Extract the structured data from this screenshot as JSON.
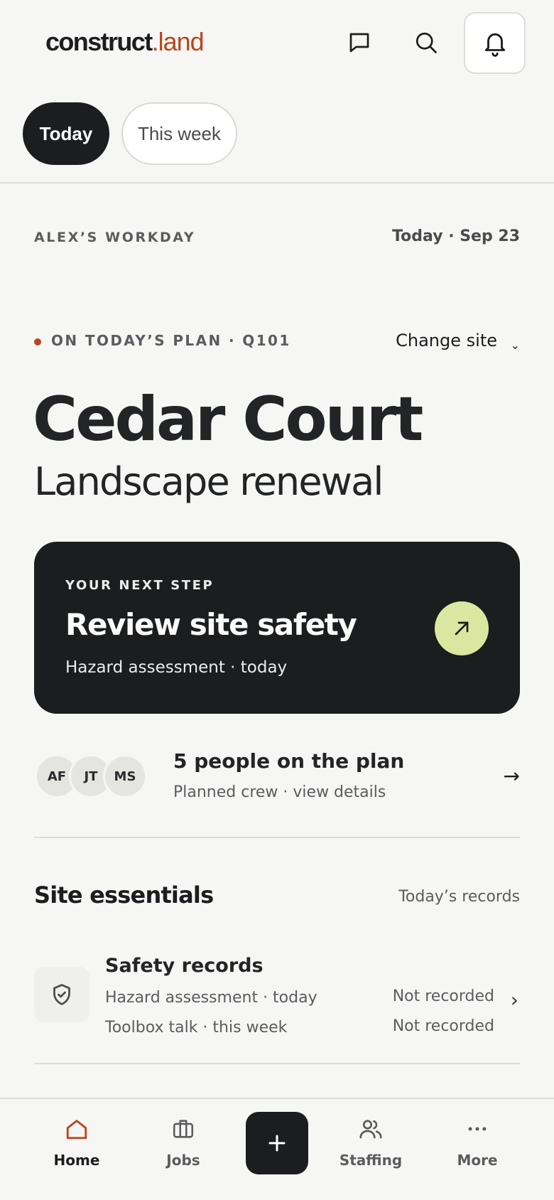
{
  "header": {
    "logo_main": "construct",
    "logo_dot": ".",
    "logo_tld": "land",
    "icons": [
      "chat-icon",
      "search-icon",
      "bell-icon"
    ]
  },
  "tabs": [
    {
      "label": "Today",
      "active": true
    },
    {
      "label": "This week",
      "active": false
    }
  ],
  "workday": {
    "label": "ALEX’S WORKDAY",
    "date": "Today · Sep 23"
  },
  "plan": {
    "label": "ON TODAY’S PLAN · Q101",
    "change_site": "Change site",
    "chevron": "⌄"
  },
  "site": {
    "title": "Cedar Court",
    "subtitle": "Landscape renewal"
  },
  "next_step": {
    "eyebrow": "YOUR NEXT STEP",
    "title": "Review site safety",
    "subtitle": "Hazard assessment · today"
  },
  "crew": {
    "avatars": [
      "AF",
      "JT",
      "MS"
    ],
    "title": "5 people on the plan",
    "subtitle": "Planned crew · view details",
    "arrow": "→"
  },
  "essentials": {
    "title": "Site essentials",
    "link": "Today’s records",
    "records": {
      "title": "Safety records",
      "items": [
        {
          "label": "Hazard assessment · today",
          "status": "Not recorded"
        },
        {
          "label": "Toolbox talk · this week",
          "status": "Not recorded"
        }
      ],
      "chevron": "›"
    }
  },
  "nav": {
    "items": [
      {
        "label": "Home",
        "active": true
      },
      {
        "label": "Jobs",
        "active": false
      },
      {
        "label": "Staffing",
        "active": false
      },
      {
        "label": "More",
        "active": false
      }
    ]
  },
  "colors": {
    "accent": "#b7471d",
    "dark": "#1c1d1f",
    "lime": "#dbe7a1",
    "background": "#f6f6f4"
  }
}
